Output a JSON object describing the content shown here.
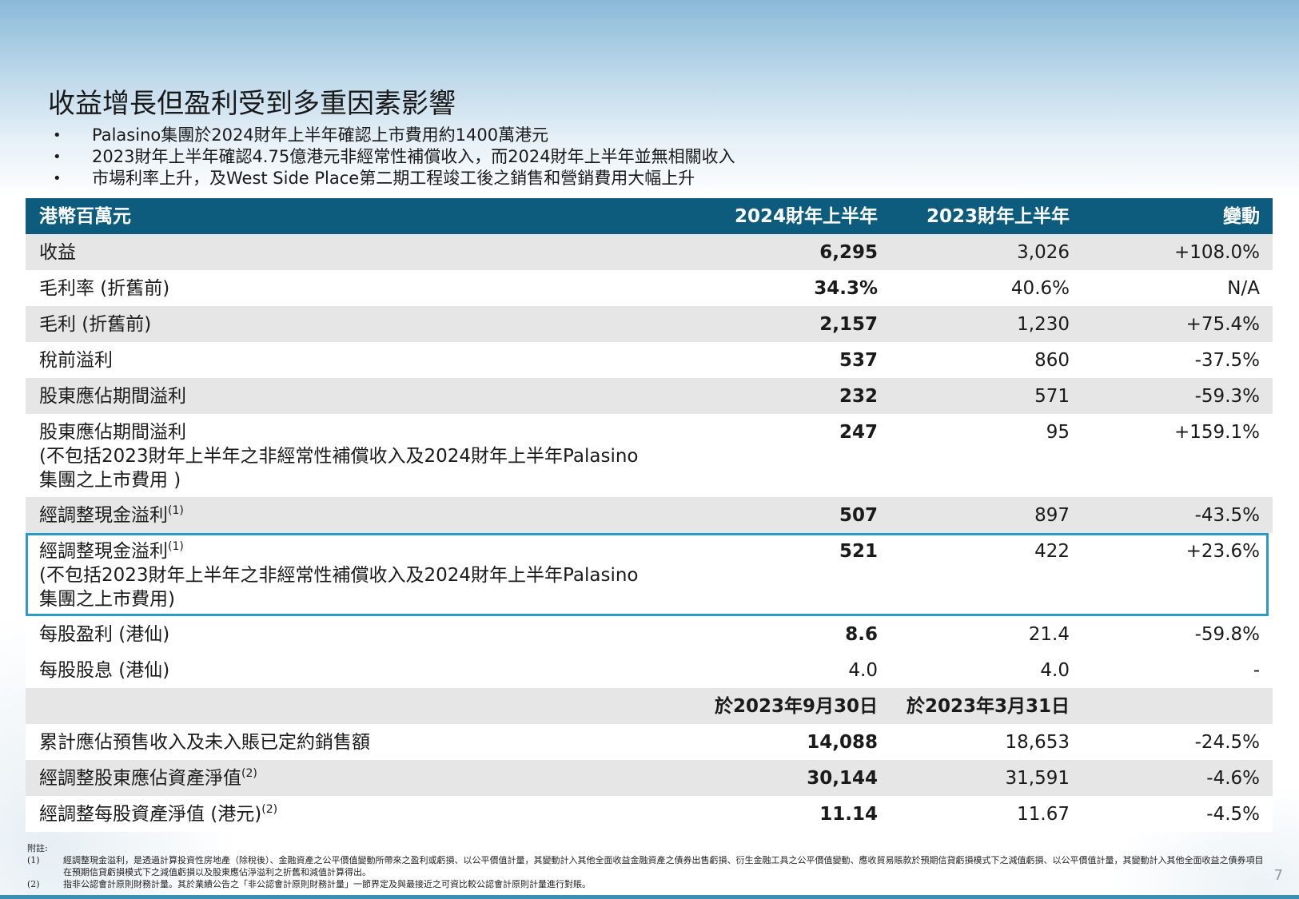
{
  "title": "收益增長但盈利受到多重因素影響",
  "bullets": [
    "Palasino集團於2024財年上半年確認上市費用約1400萬港元",
    "2023財年上半年確認4.75億港元非經常性補償收入，而2024財年上半年並無相關收入",
    "市場利率上升，及West Side Place第二期工程竣工後之銷售和營銷費用大幅上升"
  ],
  "bullet_marker": "•",
  "table": {
    "header": {
      "label": "港幣百萬元",
      "col_a": "2024財年上半年",
      "col_b": "2023財年上半年",
      "col_c": "變動"
    },
    "rows": [
      {
        "label": "收益",
        "a": "6,295",
        "b": "3,026",
        "c": "+108.0%"
      },
      {
        "label": "毛利率 (折舊前)",
        "a": "34.3%",
        "b": "40.6%",
        "c": "N/A"
      },
      {
        "label": "毛利 (折舊前)",
        "a": "2,157",
        "b": "1,230",
        "c": "+75.4%"
      },
      {
        "label": "稅前溢利",
        "a": "537",
        "b": "860",
        "c": "-37.5%"
      },
      {
        "label": "股東應佔期間溢利",
        "a": "232",
        "b": "571",
        "c": "-59.3%"
      },
      {
        "label": "股東應佔期間溢利",
        "label2": "(不包括2023財年上半年之非經常性補償收入及2024財年上半年Palasino",
        "label3": "集團之上市費用 )",
        "a": "247",
        "b": "95",
        "c": "+159.1%"
      },
      {
        "label": "經調整現金溢利",
        "sup": "(1)",
        "a": "507",
        "b": "897",
        "c": "-43.5%"
      },
      {
        "label": "經調整現金溢利",
        "sup": "(1)",
        "label2": "(不包括2023財年上半年之非經常性補償收入及2024財年上半年Palasino",
        "label3": "集團之上市費用)",
        "a": "521",
        "b": "422",
        "c": "+23.6%"
      },
      {
        "label": "每股盈利 (港仙)",
        "a": "8.6",
        "b": "21.4",
        "c": "-59.8%"
      },
      {
        "label": "每股股息 (港仙)",
        "a": "4.0",
        "b": "4.0",
        "c": "-"
      }
    ],
    "date_header": {
      "a": "於2023年9月30日",
      "b": "於2023年3月31日"
    },
    "rows2": [
      {
        "label": "累計應佔預售收入及未入賬已定約銷售額",
        "a": "14,088",
        "b": "18,653",
        "c": "-24.5%"
      },
      {
        "label": "經調整股東應佔資產淨值",
        "sup": "(2)",
        "a": "30,144",
        "b": "31,591",
        "c": "-4.6%"
      },
      {
        "label": "經調整每股資產淨值 (港元)",
        "sup": "(2)",
        "a": "11.14",
        "b": "11.67",
        "c": "-4.5%"
      }
    ]
  },
  "notes": {
    "heading": "附註:",
    "items": [
      {
        "num": "(1)",
        "text": "經調整現金溢利，是透過計算投資性房地產（除稅後）、金融資產之公平價值變動所帶來之盈利或虧損、以公平價值計量，其變動計入其他全面收益金融資產之債券出售虧損、衍生金融工具之公平價值變動、應收貿易賬款於預期信貸虧損模式下之減值虧損、以公平價值計量，其變動計入其他全面收益之債券項目在預期信貸虧損模式下之減值虧損以及股東應佔淨溢利之折舊和減值計算得出。"
      },
      {
        "num": "(2)",
        "text": "指非公認會計原則財務計量。其於業績公告之「非公認會計原則財務計量」一節界定及與最接近之可資比較公認會計原則計量進行對賬。"
      }
    ]
  },
  "page_number": "7",
  "colors": {
    "header_bg": "#0d5c7d",
    "highlight_border": "#2a9ac7",
    "row_grey": "#e6e6e6"
  }
}
